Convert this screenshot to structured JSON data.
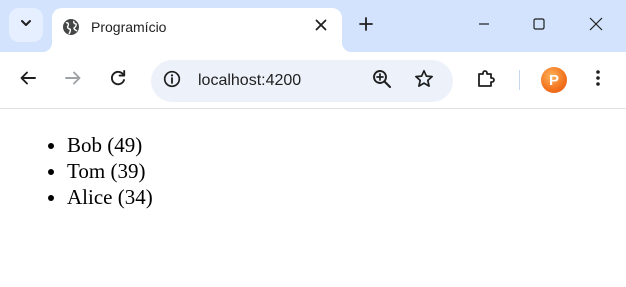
{
  "browser": {
    "tab": {
      "title": "Programício",
      "favicon_icon": "globe-icon",
      "close_icon": "close-icon"
    },
    "tab_search_icon": "chevron-down-icon",
    "new_tab_icon": "plus-icon",
    "window_controls": {
      "minimize_icon": "minimize-icon",
      "maximize_icon": "maximize-icon",
      "close_icon": "close-icon"
    },
    "toolbar": {
      "back_icon": "arrow-left-icon",
      "forward_icon": "arrow-right-icon",
      "reload_icon": "reload-icon",
      "site_info_icon": "info-icon",
      "url": "localhost:4200",
      "zoom_icon": "zoom-in-icon",
      "bookmark_icon": "star-icon",
      "extensions_icon": "puzzle-icon",
      "profile_letter": "P",
      "menu_icon": "kebab-menu-icon"
    },
    "colors": {
      "tabstrip_bg": "#d3e3fd",
      "omnibox_bg": "#edf2fa",
      "profile_accent": "#f2711c"
    }
  },
  "page": {
    "people": [
      {
        "label": "Bob (49)"
      },
      {
        "label": "Tom (39)"
      },
      {
        "label": "Alice (34)"
      }
    ]
  }
}
